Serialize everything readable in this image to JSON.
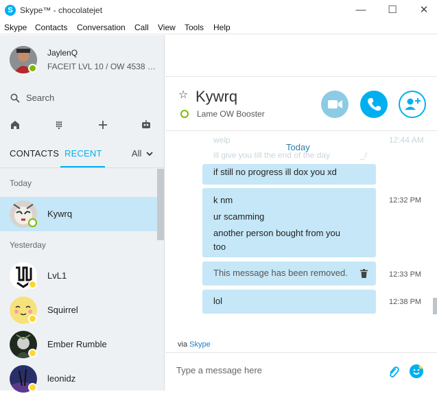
{
  "window": {
    "title": "Skype™ - chocolatejet",
    "minimize": "—",
    "maximize": "☐",
    "close": "✕"
  },
  "menu": [
    {
      "label": "Skype"
    },
    {
      "label": "Contacts"
    },
    {
      "label": "Conversation"
    },
    {
      "label": "Call"
    },
    {
      "label": "View"
    },
    {
      "label": "Tools"
    },
    {
      "label": "Help"
    }
  ],
  "profile": {
    "name": "JaylenQ",
    "status": "FACEIT LVL 10 / OW 4538 P...",
    "presence": "online"
  },
  "search": {
    "label": "Search"
  },
  "sidebar_tools": [
    {
      "icon": "home-icon"
    },
    {
      "icon": "dialpad-icon"
    },
    {
      "icon": "plus-icon"
    },
    {
      "icon": "bot-icon"
    }
  ],
  "tabs": {
    "contacts": "CONTACTS",
    "recent": "RECENT",
    "filter": "All"
  },
  "sections": {
    "today": "Today",
    "yesterday": "Yesterday"
  },
  "contacts": [
    {
      "name": "Kywrq",
      "presence": "online",
      "selected": true
    },
    {
      "name": "LvL1",
      "presence": "away"
    },
    {
      "name": "Squirrel",
      "presence": "away"
    },
    {
      "name": "Ember Rumble",
      "presence": "away"
    },
    {
      "name": "leonidz",
      "presence": "away"
    }
  ],
  "chat": {
    "name": "Kywrq",
    "mood": "Lame OW Booster",
    "ghost_lines": [
      "welp",
      "ill give you till the end of the day",
      "12:44 AM",
      "_/"
    ],
    "today_label": "Today",
    "messages": [
      {
        "lines": [
          "if still no progress ill dox you xd"
        ],
        "time": ""
      },
      {
        "lines": [
          "k nm",
          "ur scamming",
          "another person bought from you",
          "too"
        ],
        "time": "12:32 PM"
      },
      {
        "lines": [
          "This message has been removed."
        ],
        "time": "12:33 PM",
        "removed": true
      },
      {
        "lines": [
          "lol"
        ],
        "time": "12:38 PM"
      }
    ],
    "via_prefix": "via",
    "via_link": "Skype",
    "composer_placeholder": "Type a message here"
  },
  "colors": {
    "accent": "#00aff0",
    "bubble": "#c6e7f7",
    "sidebar_bg": "#eef1f4",
    "online": "#7fba00",
    "away": "#fdd632"
  }
}
